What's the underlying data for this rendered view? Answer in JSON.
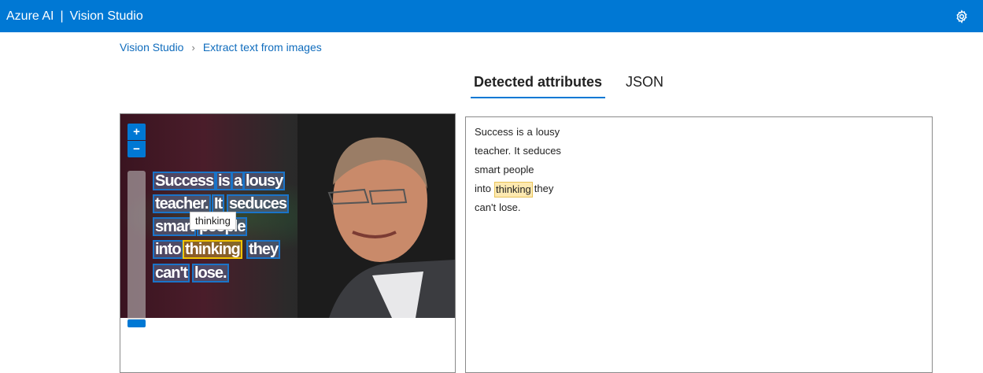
{
  "header": {
    "brand": "Azure AI",
    "separator": "|",
    "product": "Vision Studio",
    "settings_icon": "gear-icon"
  },
  "breadcrumb": {
    "home": "Vision Studio",
    "current": "Extract text from images"
  },
  "tabs": [
    {
      "label": "Detected attributes",
      "active": true
    },
    {
      "label": "JSON",
      "active": false
    }
  ],
  "image_viewer": {
    "zoom_in": "+",
    "zoom_out": "−",
    "tooltip": "thinking",
    "words": [
      "Success",
      "is",
      "a",
      "lousy",
      "teacher.",
      "It",
      "seduces",
      "smart",
      "people",
      "into",
      "thinking",
      "they",
      "can't",
      "lose."
    ]
  },
  "detected_text": {
    "lines": [
      [
        "Success",
        "is",
        "a",
        "lousy"
      ],
      [
        "teacher.",
        "It",
        "seduces"
      ],
      [
        "smart",
        "people"
      ],
      [
        "into",
        "thinking",
        "they"
      ],
      [
        "can't",
        "lose."
      ]
    ],
    "highlighted_word": "thinking"
  },
  "colors": {
    "accent": "#0078d4",
    "highlight": "#f2c400"
  }
}
